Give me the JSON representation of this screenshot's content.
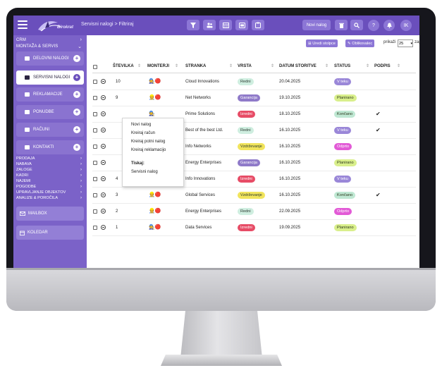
{
  "header": {
    "logo_text": "Birokrat",
    "breadcrumb": "Servisni nalogi > Filtriraj",
    "tools": [
      {
        "icon": "filter-icon"
      },
      {
        "icon": "people-icon"
      },
      {
        "icon": "calendar-grid-icon"
      },
      {
        "icon": "card-icon"
      },
      {
        "icon": "clipboard-icon"
      }
    ],
    "new_order_label": "Novi nalog",
    "user_initials": "IK",
    "right_icons": [
      "trash-icon",
      "search-icon",
      "help-icon",
      "bell-icon"
    ]
  },
  "sidebar": {
    "crm": "CRM",
    "montaza": "MONTAŽA & SERVIS",
    "items": [
      {
        "label": "DELOVNI NALOGI",
        "icon": "truck-icon"
      },
      {
        "label": "SERVISNI NALOGI",
        "icon": "wrench-icon"
      },
      {
        "label": "REKLAMACIJE",
        "icon": "users-icon"
      },
      {
        "label": "PONUDBE",
        "icon": "document-icon"
      },
      {
        "label": "RAČUNI",
        "icon": "receipt-icon"
      },
      {
        "label": "KONTAKTI",
        "icon": "contacts-icon"
      }
    ],
    "sections": [
      "PRODAJA",
      "NABAVA",
      "ZALOGE",
      "KADRI",
      "NAJEMI",
      "POGODBE",
      "UPRAVLJANJE OBJEKTOV",
      "ANALIZE & POROČILA"
    ],
    "mailbox": "MAILBOX",
    "koledar": "KOLEDAR"
  },
  "toolbar": {
    "edit_columns": "Uredi stolpce",
    "formatter": "Oblikovalec",
    "show_label": "prikaži",
    "page_size": "25",
    "records_label": "zapisov"
  },
  "table": {
    "columns": [
      "ŠTEVILKA",
      "MONTERJI",
      "STRANKA",
      "VRSTA",
      "DATUM STORITVE",
      "STATUS",
      "PODPIS"
    ],
    "rows": [
      {
        "number": "10",
        "client": "Cloud Innovations",
        "type": "Redni",
        "date": "20.04.2025",
        "status": "V teku",
        "signed": ""
      },
      {
        "number": "9",
        "client": "Net Networks",
        "type": "Garancija",
        "date": "19.10.2025",
        "status": "Planirano",
        "signed": ""
      },
      {
        "number": "",
        "client": "Prime Solutions",
        "type": "Izredni",
        "date": "18.10.2025",
        "status": "Končano",
        "signed": "✔"
      },
      {
        "number": "",
        "client": "Best of the best Ltd.",
        "type": "Redni",
        "date": "16.10.2025",
        "status": "V teku",
        "signed": "✔"
      },
      {
        "number": "",
        "client": "Info Networks",
        "type": "Vzdrževanje",
        "date": "16.10.2025",
        "status": "Odprto",
        "signed": ""
      },
      {
        "number": "",
        "client": "Energy Enterprises",
        "type": "Garancija",
        "date": "16.10.2025",
        "status": "Planirano",
        "signed": ""
      },
      {
        "number": "4",
        "client": "Info Innovations",
        "type": "Izredni",
        "date": "16.10.2025",
        "status": "V teku",
        "signed": ""
      },
      {
        "number": "3",
        "client": "Global Services",
        "type": "Vzdrževanje",
        "date": "16.10.2025",
        "status": "Končano",
        "signed": "✔"
      },
      {
        "number": "2",
        "client": "Energy Enterprises",
        "type": "Redni",
        "date": "22.09.2025",
        "status": "Odprto",
        "signed": ""
      },
      {
        "number": "1",
        "client": "Data Services",
        "type": "Izredni",
        "date": "19.09.2025",
        "status": "Planirano",
        "signed": ""
      }
    ]
  },
  "context_menu": {
    "items": [
      "Novi nalog",
      "Kreiraj račun",
      "Kreiraj potni nalog",
      "Kreiraj reklamacijo"
    ],
    "print_label": "Tiskaj:",
    "print_items": [
      "Servisni nalog"
    ]
  },
  "colors": {
    "topbar": "#6a4fbc",
    "sidebar": "#7b62c8",
    "type": {
      "Redni": "#cfeee0",
      "Garancija": "#8f7ac9",
      "Izredni": "#e74c66",
      "Vzdrževanje": "#f1e45c"
    },
    "status": {
      "V teku": "#9a87d8",
      "Planirano": "#d9ef8c",
      "Končano": "#bfe8d3",
      "Odprto": "#e25ad6"
    }
  }
}
